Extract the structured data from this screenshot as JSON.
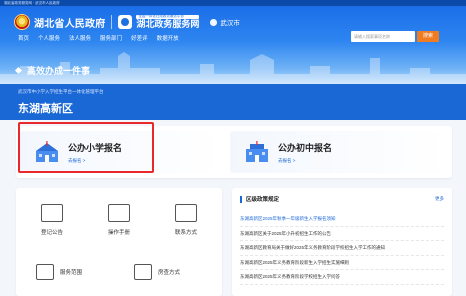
{
  "top_strip": {
    "text": "湖北省政务服务网 · 武汉市人民政府"
  },
  "header": {
    "site_name": "湖北省人民政府",
    "service_tagline": "全国一体化在线政务服务平台",
    "service_name": "湖北政务服务网",
    "location": "武汉市",
    "nav": [
      "首页",
      "个人服务",
      "法人服务",
      "服务部门",
      "好差评",
      "数据开放"
    ],
    "search_placeholder": "请输入搜索事项名称",
    "search_button": "搜索",
    "page_title": "高效办成一件事"
  },
  "band": {
    "subtitle": "武汉市中小学入学招生平台一体化管理平台",
    "district": "东湖高新区"
  },
  "registration": [
    {
      "title": "公办小学报名",
      "link": "去报名 >"
    },
    {
      "title": "公办初中报名",
      "link": "去报名 >"
    }
  ],
  "grid": {
    "row1": [
      {
        "label": "登记公告",
        "icon": "notice-icon"
      },
      {
        "label": "操作手册",
        "icon": "manual-icon"
      },
      {
        "label": "联系方式",
        "icon": "mail-icon"
      }
    ],
    "row2": [
      {
        "label": "服务范围",
        "icon": "service-scope-icon"
      },
      {
        "label": "房查方式",
        "icon": "search-house-icon"
      }
    ]
  },
  "policy": {
    "title": "区级政策规定",
    "more": "更多",
    "items": [
      "东湖高新区2025年秋季一年级新生入学报名须知",
      "东湖高新区关于2025年小升初招生工作的公告",
      "东湖高新区教育局关于做好2025年义务教育阶段学校招生入学工作的通知",
      "东湖高新区2025年义务教育阶段新生入学招生实施细则",
      "东湖高新区2025年义务教育阶段学校招生入学问答"
    ]
  },
  "colors": {
    "primary": "#1a67d6",
    "highlight": "#e8282a",
    "search_button": "#f07c22"
  }
}
